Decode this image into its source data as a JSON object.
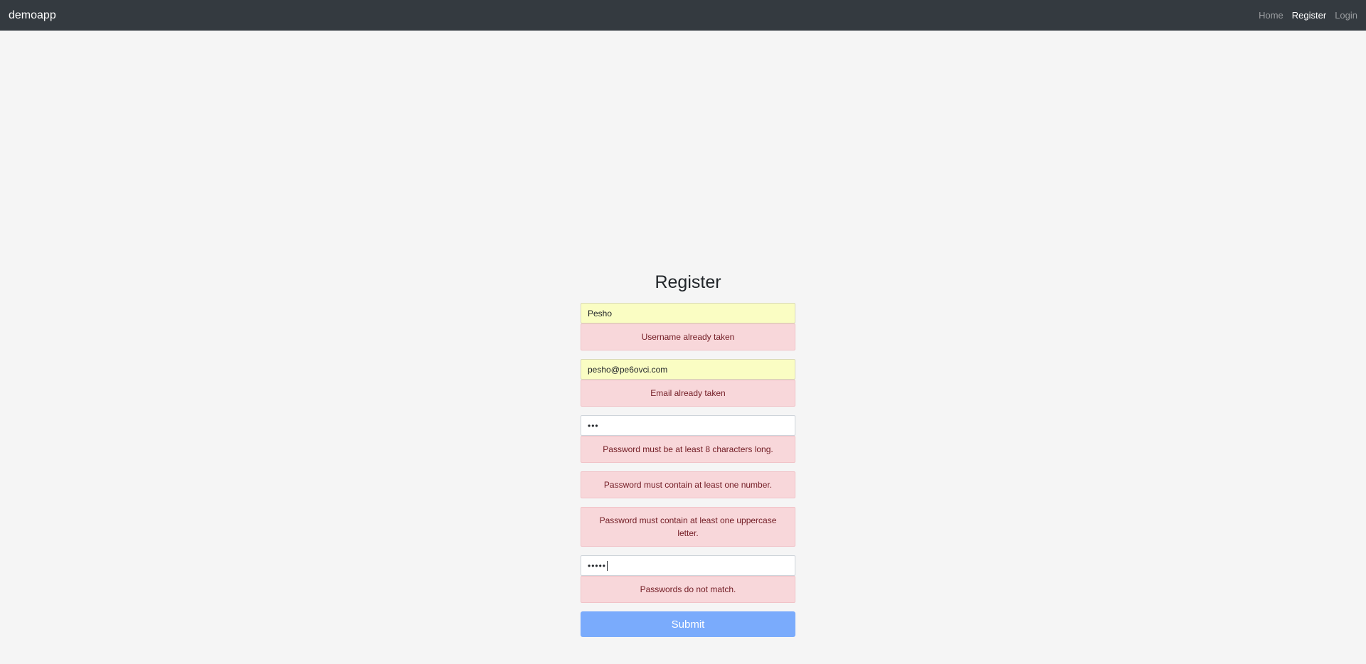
{
  "navbar": {
    "brand": "demoapp",
    "links": [
      {
        "label": "Home"
      },
      {
        "label": "Register"
      },
      {
        "label": "Login"
      }
    ]
  },
  "form": {
    "title": "Register",
    "username": {
      "value": "Pesho",
      "errors": [
        "Username already taken"
      ]
    },
    "email": {
      "value": "pesho@pe6ovci.com",
      "errors": [
        "Email already taken"
      ]
    },
    "password": {
      "value": "•••",
      "errors": [
        "Password must be at least 8 characters long.",
        "Password must contain at least one number.",
        "Password must contain at least one uppercase letter."
      ]
    },
    "confirm_password": {
      "value": "•••••",
      "errors": [
        "Passwords do not match."
      ]
    },
    "submit_label": "Submit"
  },
  "colors": {
    "navbar_bg": "#343a40",
    "alert_bg": "#f8d7da",
    "alert_text": "#721c24",
    "autofill_bg": "#fafdc3",
    "submit_bg": "#7aabfc"
  }
}
